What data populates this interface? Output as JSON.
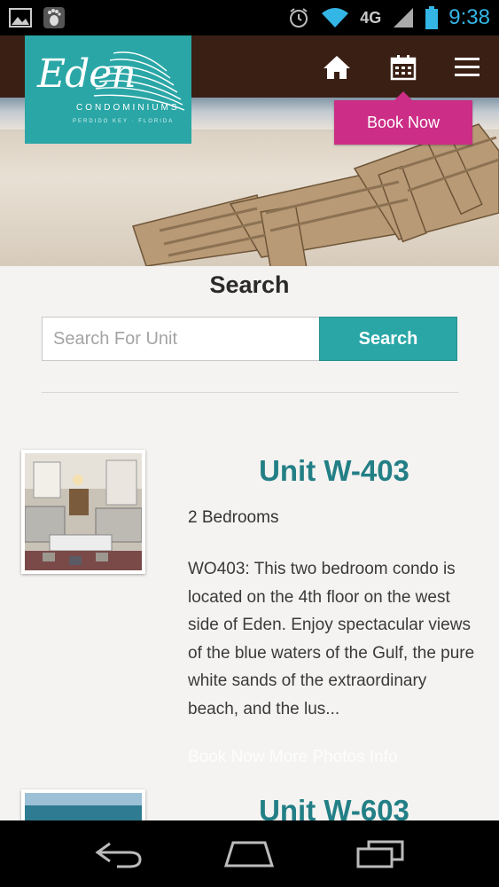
{
  "status_bar": {
    "time": "9:38",
    "network": "4G",
    "icons": [
      "image-icon",
      "footprint-icon",
      "alarm-icon",
      "wifi-icon",
      "lte-icon",
      "signal-icon",
      "battery-icon"
    ]
  },
  "header": {
    "logo": {
      "script": "Eden",
      "subtitle": "CONDOMINIUMS",
      "tagline": "PERDIDO KEY · FLORIDA"
    },
    "nav_icons": [
      "home-icon",
      "calendar-icon",
      "menu-icon"
    ],
    "book_now_label": "Book Now"
  },
  "search": {
    "title": "Search",
    "placeholder": "Search For Unit",
    "button_label": "Search"
  },
  "listings": [
    {
      "title": "Unit W-403",
      "bedrooms": "2 Bedrooms",
      "description": "WO403: This two bedroom condo is located on the 4th floor on the west side of Eden. Enjoy spectacular views of the blue waters of the Gulf, the pure white sands of the extraordinary beach, and the lus...",
      "link_text": "Book Now More Photos Info"
    },
    {
      "title": "Unit W-603"
    }
  ],
  "nav_bar": {
    "icons": [
      "back-icon",
      "home-nav-icon",
      "recent-apps-icon"
    ]
  },
  "colors": {
    "teal": "#2aa6a6",
    "title_teal": "#237f86",
    "magenta": "#cc2d86",
    "header_brown": "#3a1f14"
  }
}
